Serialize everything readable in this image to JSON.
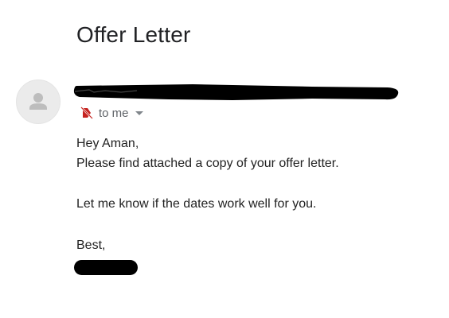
{
  "email": {
    "subject": "Offer Letter",
    "sender_avatar_icon": "person-icon",
    "important_marker_icon": "importance-off-icon",
    "recipient_text": "to me",
    "recipient_chevron_icon": "chevron-down-icon",
    "body": {
      "greeting": "Hey Aman,",
      "line_attachment": "Please find attached a copy of your offer letter.",
      "line_dates": "Let me know if the dates work well for you.",
      "closing": "Best,"
    }
  },
  "colors": {
    "marker_red": "#c5221f",
    "secondary_text": "#5f6368",
    "redaction": "#000000"
  }
}
